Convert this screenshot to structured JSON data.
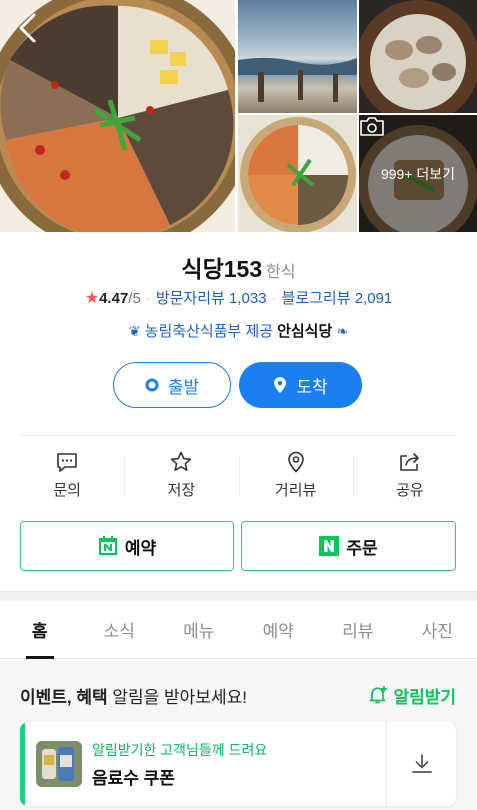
{
  "place": {
    "name": "식당153",
    "category": "한식",
    "rating": "4.47",
    "rating_max": "/5",
    "visitor_reviews": "방문자리뷰 1,033",
    "blog_reviews": "블로그리뷰 2,091",
    "badge_text": "농림축산식품부 제공",
    "badge_brand": "안심식당"
  },
  "photos": {
    "more_label": "999+ 더보기"
  },
  "route": {
    "depart": "출발",
    "arrive": "도착"
  },
  "actions": [
    {
      "label": "문의",
      "icon": "chat-icon"
    },
    {
      "label": "저장",
      "icon": "star-icon"
    },
    {
      "label": "거리뷰",
      "icon": "location-pin-icon"
    },
    {
      "label": "공유",
      "icon": "share-icon"
    }
  ],
  "booking": {
    "reserve": "예약",
    "order": "주문"
  },
  "tabs": [
    {
      "label": "홈",
      "active": true
    },
    {
      "label": "소식"
    },
    {
      "label": "메뉴"
    },
    {
      "label": "예약"
    },
    {
      "label": "리뷰"
    },
    {
      "label": "사진"
    }
  ],
  "event": {
    "bold": "이벤트, 혜택",
    "rest": " 알림을 받아보세요!",
    "alarm_label": "알림받기"
  },
  "coupon": {
    "subtitle": "알림받기한 고객님들께 드려요",
    "title": "음료수 쿠폰"
  },
  "colors": {
    "accent_blue": "#1a7ff2",
    "naver_green": "#03c75a",
    "star_red": "#ff5555"
  }
}
